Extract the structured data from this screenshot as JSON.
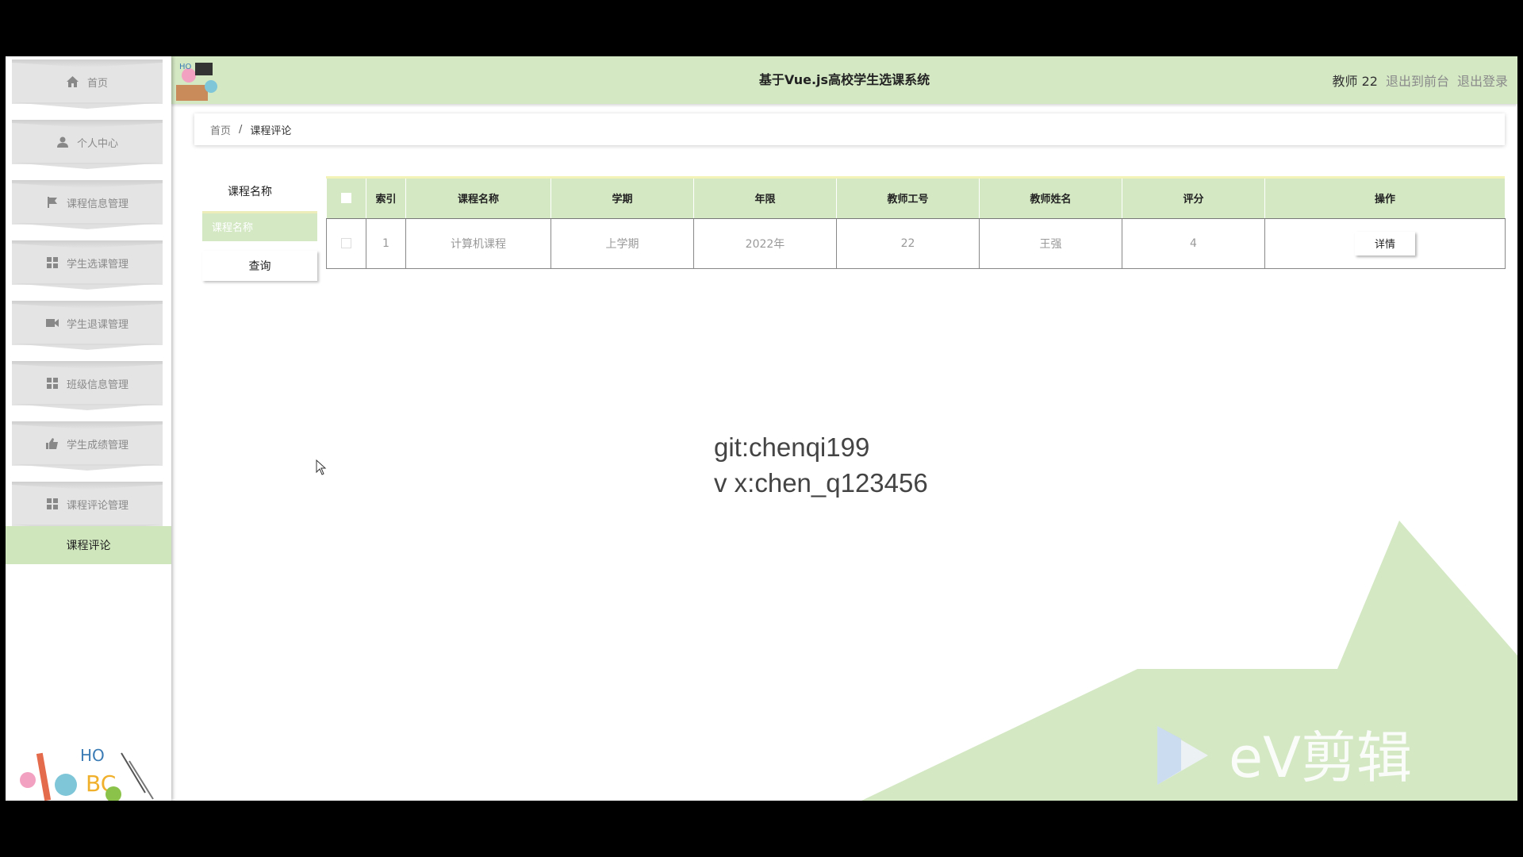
{
  "sidebar": {
    "items": [
      {
        "label": "首页",
        "icon": "home-icon"
      },
      {
        "label": "个人中心",
        "icon": "user-icon"
      },
      {
        "label": "课程信息管理",
        "icon": "flag-icon"
      },
      {
        "label": "学生选课管理",
        "icon": "grid-icon"
      },
      {
        "label": "学生退课管理",
        "icon": "video-icon"
      },
      {
        "label": "班级信息管理",
        "icon": "grid-icon"
      },
      {
        "label": "学生成绩管理",
        "icon": "thumbs-up-icon"
      },
      {
        "label": "课程评论管理",
        "icon": "grid-icon"
      }
    ],
    "sub_item": "课程评论"
  },
  "header": {
    "title": "基于Vue.js高校学生选课系统",
    "user": "教师 22",
    "back_to_front": "退出到前台",
    "logout": "退出登录"
  },
  "breadcrumb": {
    "home": "首页",
    "separator": "/",
    "current": "课程评论"
  },
  "search": {
    "label": "课程名称",
    "placeholder": "课程名称",
    "button": "查询"
  },
  "table": {
    "headers": [
      "索引",
      "课程名称",
      "学期",
      "年限",
      "教师工号",
      "教师姓名",
      "评分",
      "操作"
    ],
    "rows": [
      {
        "index": "1",
        "course": "计算机课程",
        "term": "上学期",
        "year": "2022年",
        "teacher_id": "22",
        "teacher_name": "王强",
        "score": "4",
        "action": "详情"
      }
    ]
  },
  "overlay": {
    "line1": "git:chenqi199",
    "line2": "v x:chen_q123456",
    "brand": "eV剪辑"
  },
  "colors": {
    "accent": "#d4e8c4",
    "sidebar_item": "#e4e4e4",
    "active_sub": "#cfe6bd",
    "table_top": "#f3f3b8"
  }
}
